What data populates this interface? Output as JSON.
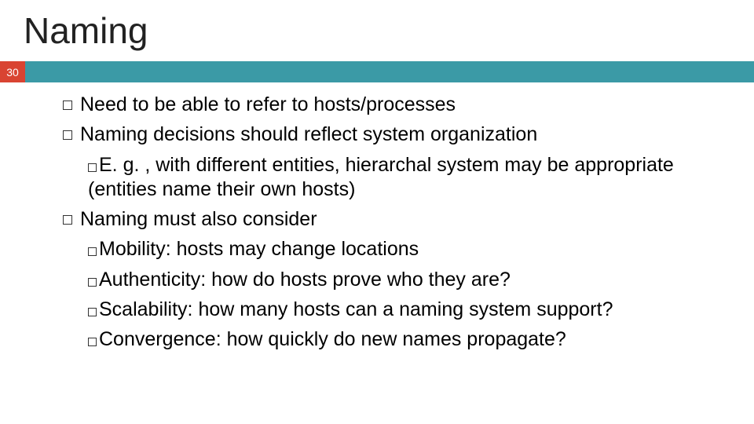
{
  "title": "Naming",
  "slide_number": "30",
  "b1": "Need to be able to refer to hosts/processes",
  "b2": "Naming decisions should reflect system organization",
  "b2a": "E. g. , with different entities, hierarchal system may be appropriate (entities name their own hosts)",
  "b3": "Naming must also consider",
  "b3a": "Mobility: hosts may change locations",
  "b3b": "Authenticity: how do hosts prove who they are?",
  "b3c": "Scalability: how many hosts can a naming system support?",
  "b3d": "Convergence: how quickly do new names propagate?"
}
